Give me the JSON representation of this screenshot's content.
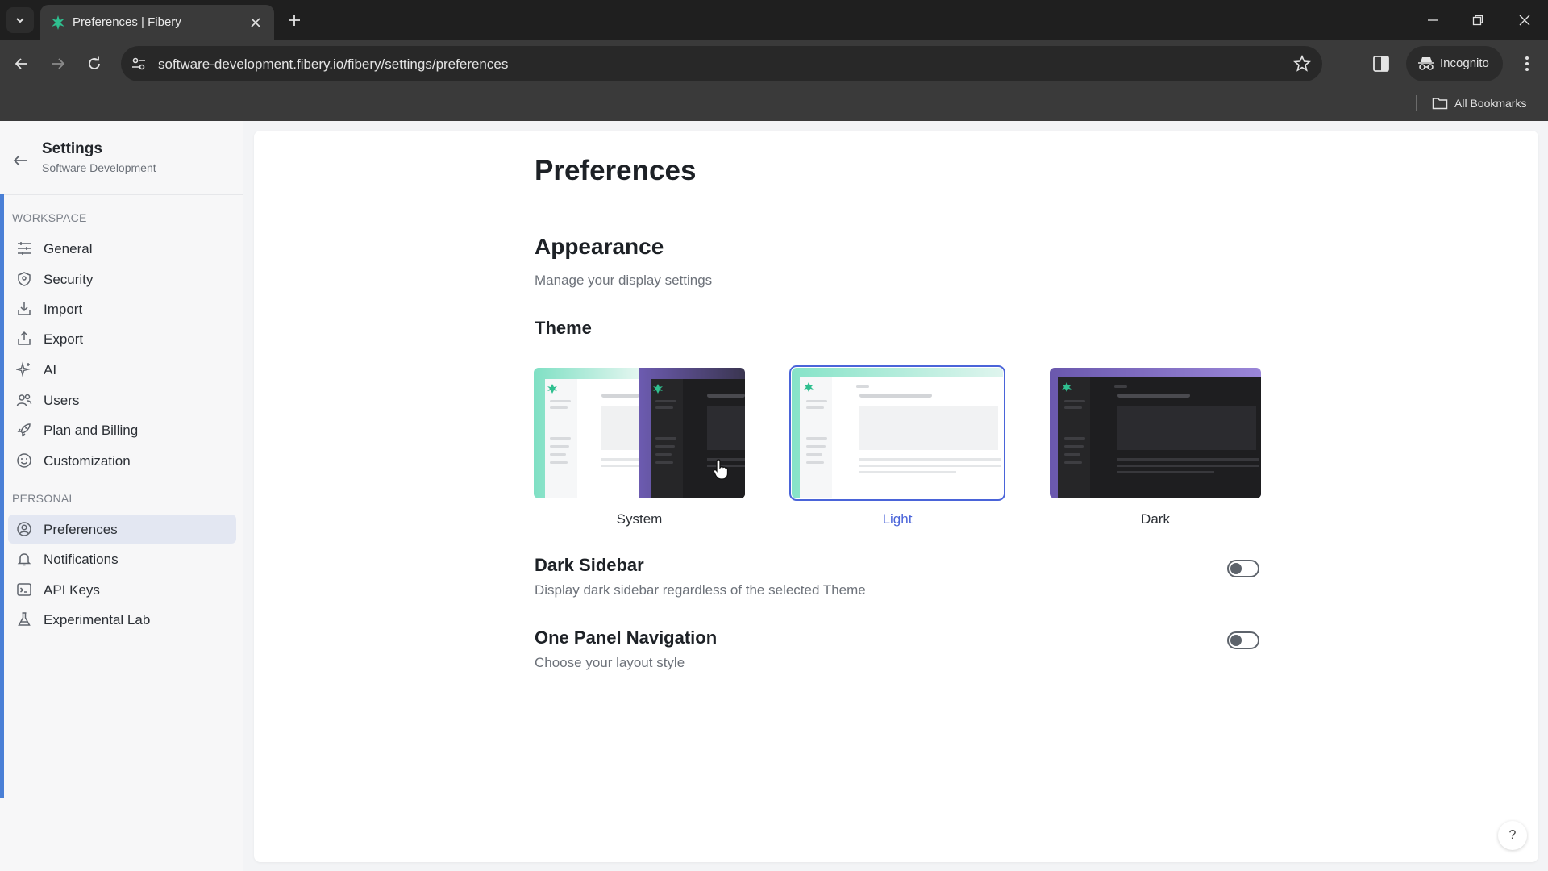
{
  "browser": {
    "tab_title": "Preferences | Fibery",
    "url": "software-development.fibery.io/fibery/settings/preferences",
    "incognito_label": "Incognito",
    "bookmarks_label": "All Bookmarks"
  },
  "sidebar": {
    "title": "Settings",
    "subtitle": "Software Development",
    "workspace_heading": "WORKSPACE",
    "personal_heading": "PERSONAL",
    "workspace_items": [
      {
        "label": "General",
        "icon": "sliders-icon"
      },
      {
        "label": "Security",
        "icon": "shield-icon"
      },
      {
        "label": "Import",
        "icon": "import-icon"
      },
      {
        "label": "Export",
        "icon": "export-icon"
      },
      {
        "label": "AI",
        "icon": "sparkle-icon"
      },
      {
        "label": "Users",
        "icon": "users-icon"
      },
      {
        "label": "Plan and Billing",
        "icon": "rocket-icon"
      },
      {
        "label": "Customization",
        "icon": "smiley-icon"
      }
    ],
    "personal_items": [
      {
        "label": "Preferences",
        "icon": "user-circle-icon",
        "active": true
      },
      {
        "label": "Notifications",
        "icon": "bell-icon"
      },
      {
        "label": "API Keys",
        "icon": "terminal-icon"
      },
      {
        "label": "Experimental Lab",
        "icon": "flask-icon"
      }
    ]
  },
  "main": {
    "page_title": "Preferences",
    "appearance_title": "Appearance",
    "appearance_desc": "Manage your display settings",
    "theme_title": "Theme",
    "themes": [
      {
        "label": "System",
        "selected": false
      },
      {
        "label": "Light",
        "selected": true
      },
      {
        "label": "Dark",
        "selected": false
      }
    ],
    "dark_sidebar": {
      "title": "Dark Sidebar",
      "desc": "Display dark sidebar regardless of the selected Theme",
      "enabled": false
    },
    "one_panel": {
      "title": "One Panel Navigation",
      "desc": "Choose your layout style",
      "enabled": false
    }
  },
  "help_label": "?",
  "colors": {
    "accent": "#4a64d9",
    "brand_green": "#2fbf8f",
    "stripe": "#4a7fd6"
  }
}
